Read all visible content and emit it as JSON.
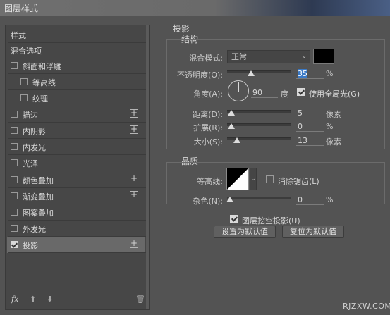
{
  "window": {
    "title": "图层样式"
  },
  "sidebar": {
    "items": [
      {
        "label": "样式"
      },
      {
        "label": "混合选项"
      },
      {
        "label": "斜面和浮雕",
        "checked": false
      },
      {
        "label": "等高线",
        "checked": false
      },
      {
        "label": "纹理",
        "checked": false
      },
      {
        "label": "描边",
        "checked": false,
        "plus": "+"
      },
      {
        "label": "内阴影",
        "checked": false,
        "plus": "+"
      },
      {
        "label": "内发光",
        "checked": false
      },
      {
        "label": "光泽",
        "checked": false
      },
      {
        "label": "颜色叠加",
        "checked": false,
        "plus": "+"
      },
      {
        "label": "渐变叠加",
        "checked": false,
        "plus": "+"
      },
      {
        "label": "图案叠加",
        "checked": false
      },
      {
        "label": "外发光",
        "checked": false
      },
      {
        "label": "投影",
        "checked": true,
        "plus": "+",
        "selected": true
      }
    ],
    "footer": {
      "fx": "fx",
      "up": "⬆",
      "down": "⬇",
      "delete": "🗑"
    }
  },
  "panel": {
    "title": "投影",
    "structure": {
      "title": "结构",
      "blend_mode_label": "混合模式:",
      "blend_mode_value": "正常",
      "shadow_color": "#000000",
      "opacity_label": "不透明度(O):",
      "opacity_value": "35",
      "opacity_unit": "%",
      "angle_label": "角度(A):",
      "angle_value": "90",
      "angle_unit": "度",
      "global_light_label": "使用全局光(G)",
      "global_light_checked": true,
      "distance_label": "距离(D):",
      "distance_value": "5",
      "distance_unit": "像素",
      "spread_label": "扩展(R):",
      "spread_value": "0",
      "spread_unit": "%",
      "size_label": "大小(S):",
      "size_value": "13",
      "size_unit": "像素"
    },
    "quality": {
      "title": "品质",
      "contour_label": "等高线:",
      "antialias_label": "消除锯齿(L)",
      "antialias_checked": false,
      "noise_label": "杂色(N):",
      "noise_value": "0",
      "noise_unit": "%"
    },
    "knockout_label": "图层挖空投影(U)",
    "knockout_checked": true,
    "make_default_button": "设置为默认值",
    "reset_default_button": "复位为默认值"
  },
  "watermark": "RJZXW.COM"
}
